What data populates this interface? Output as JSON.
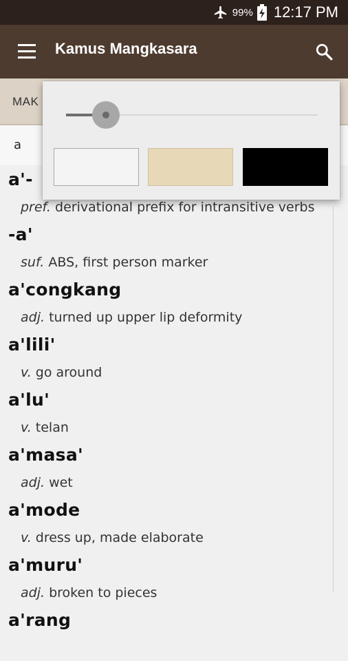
{
  "status_bar": {
    "battery_percent": "99%",
    "time": "12:17 PM",
    "icons": [
      "airplane-mode-icon",
      "battery-charging-icon"
    ]
  },
  "app_bar": {
    "title": "Kamus Mangkasara",
    "icons": [
      "menu-icon",
      "search-icon"
    ]
  },
  "tabs": {
    "visible_label": "MAK"
  },
  "search": {
    "query": "a"
  },
  "entries": [
    {
      "headword": "a'-",
      "pos": "pref.",
      "gloss": "derivational prefix for intransitive verbs"
    },
    {
      "headword": "-a'",
      "pos": "suf.",
      "gloss": "ABS, first person marker"
    },
    {
      "headword": "a'congkang",
      "pos": "adj.",
      "gloss": "turned up upper lip deformity"
    },
    {
      "headword": "a'lili'",
      "pos": "v.",
      "gloss": "go around"
    },
    {
      "headword": "a'lu'",
      "pos": "v.",
      "gloss": "telan"
    },
    {
      "headword": "a'masa'",
      "pos": "adj.",
      "gloss": "wet"
    },
    {
      "headword": "a'mode",
      "pos": "v.",
      "gloss": "dress up, made elaborate"
    },
    {
      "headword": "a'muru'",
      "pos": "adj.",
      "gloss": "broken to pieces"
    },
    {
      "headword": "a'rang",
      "pos": "",
      "gloss": ""
    }
  ],
  "popup": {
    "font_size_level": 0.15,
    "themes": [
      {
        "name": "white",
        "color": "#f4f4f4"
      },
      {
        "name": "sepia",
        "color": "#e7d8b8"
      },
      {
        "name": "black",
        "color": "#000000"
      }
    ]
  },
  "colors": {
    "status_bar": "#2d211c",
    "app_bar": "#4e3b30",
    "tab_bar": "#dcd2c6",
    "background": "#f0f0f0"
  }
}
